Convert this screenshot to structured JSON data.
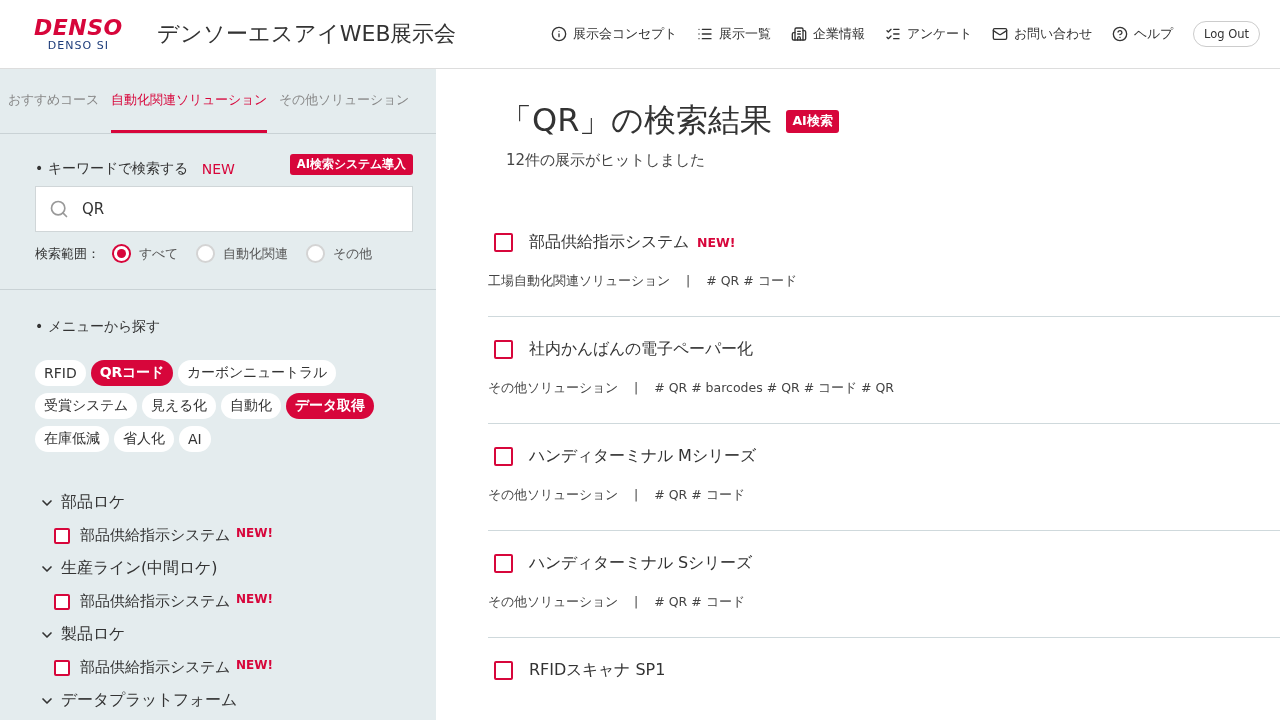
{
  "header": {
    "logo": {
      "brand": "DENSO",
      "sub": "DENSO SI"
    },
    "site_title": "デンソーエスアイWEB展示会",
    "nav": [
      {
        "label": "展示会コンセプト"
      },
      {
        "label": "展示一覧"
      },
      {
        "label": "企業情報"
      },
      {
        "label": "アンケート"
      },
      {
        "label": "お問い合わせ"
      },
      {
        "label": "ヘルプ"
      }
    ],
    "logout": "Log Out"
  },
  "sidebar": {
    "tabs": [
      {
        "label": "おすすめコース",
        "selected": false
      },
      {
        "label": "自動化関連ソリューション",
        "selected": true
      },
      {
        "label": "その他ソリューション",
        "selected": false
      }
    ],
    "keyword": {
      "label": "• キーワードで検索する",
      "new": "NEW",
      "tooltip": "AI検索システム導入",
      "value": "QR",
      "scope_label": "検索範囲：",
      "scopes": [
        {
          "label": "すべて",
          "selected": true
        },
        {
          "label": "自動化関連",
          "selected": false
        },
        {
          "label": "その他",
          "selected": false
        }
      ]
    },
    "menu_label": "• メニューから探す",
    "chips": [
      {
        "label": "RFID",
        "selected": false
      },
      {
        "label": "QRコード",
        "selected": true
      },
      {
        "label": "カーボンニュートラル",
        "selected": false
      },
      {
        "label": "受賞システム",
        "selected": false
      },
      {
        "label": "見える化",
        "selected": false
      },
      {
        "label": "自動化",
        "selected": false
      },
      {
        "label": "データ取得",
        "selected": true
      },
      {
        "label": "在庫低減",
        "selected": false
      },
      {
        "label": "省人化",
        "selected": false
      },
      {
        "label": "AI",
        "selected": false
      }
    ],
    "tree": [
      {
        "label": "部品ロケ",
        "expanded": true,
        "children": [
          {
            "label": "部品供給指示システム",
            "badge": "NEW!",
            "checked": false
          }
        ]
      },
      {
        "label": "生産ライン(中間ロケ)",
        "expanded": true,
        "children": [
          {
            "label": "部品供給指示システム",
            "badge": "NEW!",
            "checked": false
          }
        ]
      },
      {
        "label": "製品ロケ",
        "expanded": true,
        "children": [
          {
            "label": "部品供給指示システム",
            "badge": "NEW!",
            "checked": false
          }
        ]
      },
      {
        "label": "データプラットフォーム",
        "expanded": true
      }
    ]
  },
  "results": {
    "title": "「QR」の検索結果",
    "ai_badge": "AI検索",
    "count": "12件の展示がヒットしました",
    "items": [
      {
        "title": "部品供給指示システム",
        "badge": "NEW!",
        "checked": false,
        "category": "工場自動化関連ソリューション",
        "divider": "|",
        "tags": "# QR # コード"
      },
      {
        "title": "社内かんばんの電子ペーパー化",
        "checked": false,
        "category": "その他ソリューション",
        "divider": "|",
        "tags": "# QR # barcodes # QR # コード # QR"
      },
      {
        "title": "ハンディターミナル Mシリーズ",
        "checked": false,
        "category": "その他ソリューション",
        "divider": "|",
        "tags": "# QR # コード"
      },
      {
        "title": "ハンディターミナル Sシリーズ",
        "checked": false,
        "category": "その他ソリューション",
        "divider": "|",
        "tags": "# QR # コード"
      },
      {
        "title": "RFIDスキャナ SP1",
        "checked": false
      }
    ]
  }
}
